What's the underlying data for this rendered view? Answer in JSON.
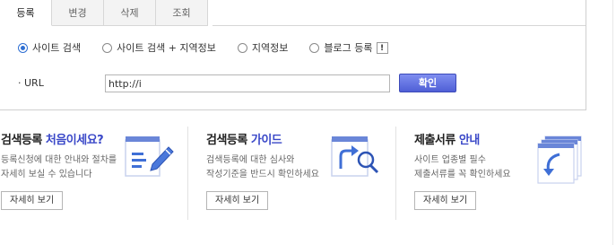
{
  "tabs": [
    {
      "label": "등록",
      "active": true
    },
    {
      "label": "변경",
      "active": false
    },
    {
      "label": "삭제",
      "active": false
    },
    {
      "label": "조회",
      "active": false
    }
  ],
  "radio_options": [
    {
      "label": "사이트 검색",
      "checked": true
    },
    {
      "label": "사이트 검색 + 지역정보",
      "checked": false
    },
    {
      "label": "지역정보",
      "checked": false
    },
    {
      "label": "블로그 등록",
      "checked": false
    }
  ],
  "info_badge": "!",
  "url": {
    "label": "· URL",
    "value": "http://i"
  },
  "confirm_label": "확인",
  "promos": [
    {
      "title_plain": "검색등록 ",
      "title_highlight": "처음이세요?",
      "desc_line1": "등록신청에 대한 안내와 절차를",
      "desc_line2": "자세히 보실 수 있습니다",
      "button": "자세히 보기",
      "icon": "document-pencil-icon"
    },
    {
      "title_plain": "검색등록 ",
      "title_highlight": "가이드",
      "desc_line1": "검색등록에 대한 심사와",
      "desc_line2": "작성기준을 반드시 확인하세요",
      "button": "자세히 보기",
      "icon": "magnifier-guide-icon"
    },
    {
      "title_plain": "제출서류 ",
      "title_highlight": "안내",
      "desc_line1": "사이트 업종별 필수",
      "desc_line2": "제출서류를 꼭 확인하세요",
      "button": "자세히 보기",
      "icon": "document-stack-icon"
    }
  ],
  "colors": {
    "accent": "#3a48c8",
    "button": "#5a69dc",
    "radio_checked": "#2f6fd3"
  }
}
